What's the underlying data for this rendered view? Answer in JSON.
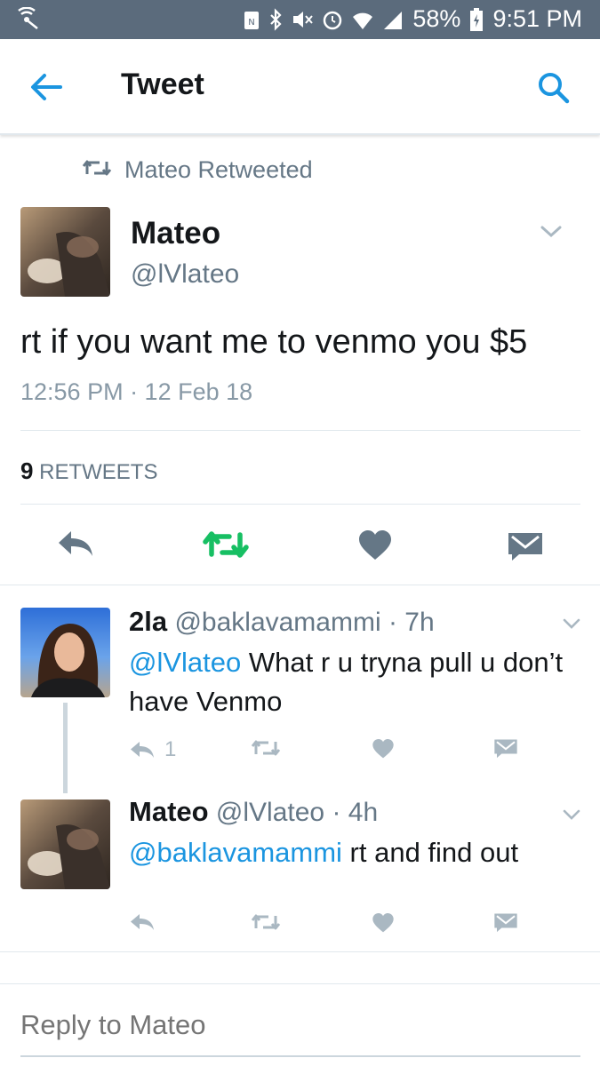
{
  "status_bar": {
    "battery": "58%",
    "time": "9:51 PM",
    "icons": [
      "signal-hotspot-icon",
      "nfc-icon",
      "bluetooth-icon",
      "mute-icon",
      "alarm-icon",
      "wifi-icon",
      "cell-signal-icon",
      "battery-charging-icon"
    ]
  },
  "header": {
    "title": "Tweet",
    "back_icon": "back-arrow-icon",
    "search_icon": "search-icon"
  },
  "retweet_context": {
    "label": "Mateo Retweeted"
  },
  "tweet": {
    "name": "Mateo",
    "handle": "@lVlateo",
    "text": "rt if you want me to venmo you $5",
    "timestamp": "12:56 PM · 12 Feb 18",
    "retweets_count": "9",
    "retweets_label": "RETWEETS",
    "colors": {
      "retweet_active": "#17bf63",
      "action_gray": "#657786",
      "link": "#1b95e0"
    }
  },
  "replies": [
    {
      "name": "2la",
      "handle": "@baklavamammi",
      "time": "· 7h",
      "mention": "@lVlateo",
      "text": " What r u tryna pull u don’t have Venmo",
      "reply_count": "1"
    },
    {
      "name": "Mateo",
      "handle": "@lVlateo",
      "time": "· 4h",
      "mention": "@baklavamammi",
      "text": " rt and find out",
      "reply_count": ""
    }
  ],
  "composer": {
    "placeholder": "Reply to Mateo"
  }
}
